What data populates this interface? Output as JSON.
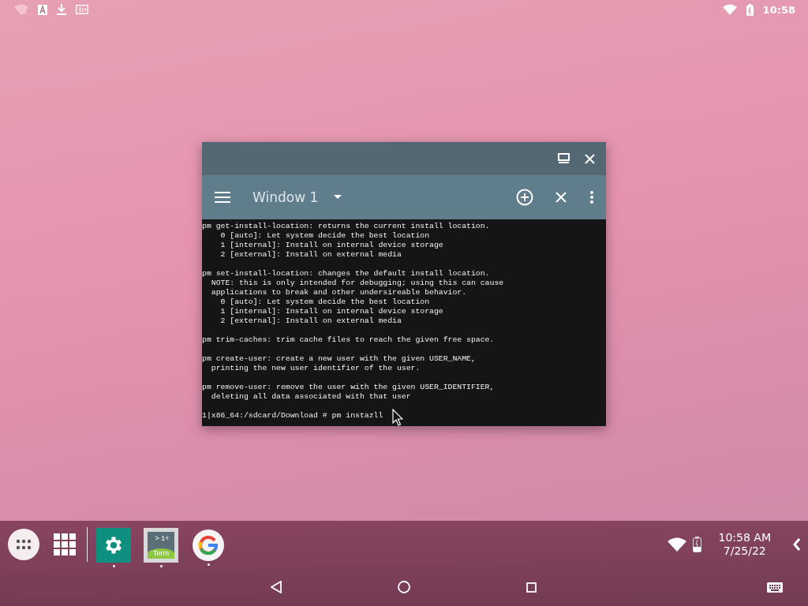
{
  "status_bar": {
    "notifications": [
      {
        "kind": "wifi-off"
      },
      {
        "kind": "font"
      },
      {
        "kind": "download"
      },
      {
        "kind": "screen"
      }
    ],
    "time": "10:58"
  },
  "window": {
    "title": "Window 1",
    "terminal": {
      "blocks": [
        [
          "pm get-install-location: returns the current install location.",
          "    0 [auto]: Let system decide the best location",
          "    1 [internal]: Install on internal device storage",
          "    2 [external]: Install on external media"
        ],
        [
          "pm set-install-location: changes the default install location.",
          "  NOTE: this is only intended for debugging; using this can cause",
          "  applications to break and other undersireable behavior.",
          "    0 [auto]: Let system decide the best location",
          "    1 [internal]: Install on internal device storage",
          "    2 [external]: Install on external media"
        ],
        [
          "pm trim-caches: trim cache files to reach the given free space."
        ],
        [
          "pm create-user: create a new user with the given USER_NAME,",
          "  printing the new user identifier of the user."
        ],
        [
          "pm remove-user: remove the user with the given USER_IDENTIFIER,",
          "  deleting all data associated with that user"
        ],
        [
          "1|x86_64:/sdcard/Download # pm instazll"
        ]
      ]
    }
  },
  "taskbar": {
    "apps": [
      {
        "kind": "settings",
        "running": true
      },
      {
        "kind": "terminal",
        "line_1": "> 1+",
        "line_2": "Term",
        "running": true
      },
      {
        "kind": "google",
        "running": true
      }
    ],
    "clock": {
      "time": "10:58 AM",
      "date": "7/25/22"
    }
  }
}
